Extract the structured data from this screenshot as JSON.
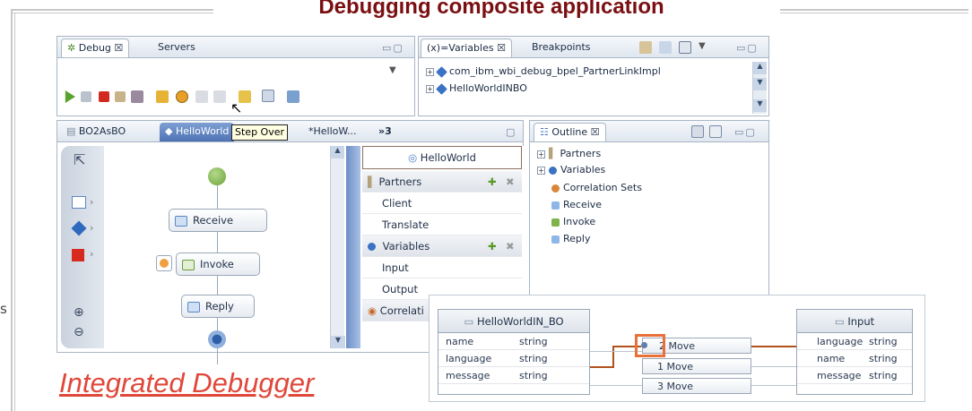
{
  "slide": {
    "title": "Debugging composite application",
    "caption": "Integrated Debugger",
    "edge_mark": "s",
    "title_color": "#7a0f12",
    "caption_color": "#e0473a"
  },
  "debug_view": {
    "tabs": [
      "Debug ☒",
      "Servers"
    ],
    "tooltip": "Step Over"
  },
  "variables_view": {
    "tabs": [
      "(x)=Variables ☒",
      "Breakpoints"
    ],
    "items": [
      "com_ibm_wbi_debug_bpel_PartnerLinkImpl",
      "HelloWorldINBO"
    ]
  },
  "editor": {
    "tabs": [
      "BO2AsBO",
      "HelloWorld",
      "*HelloW...",
      "»3"
    ],
    "process_nodes": [
      "Receive",
      "Invoke",
      "Reply"
    ],
    "process_name": "HelloWorld",
    "partners_label": "Partners",
    "partners": [
      "Client",
      "Translate"
    ],
    "variables_label": "Variables",
    "variables": [
      "Input",
      "Output"
    ],
    "correlation_label": "Correlati"
  },
  "outline_view": {
    "tab": "Outline ☒",
    "items": [
      "Partners",
      "Variables",
      "Correlation Sets",
      "Receive",
      "Invoke",
      "Reply"
    ]
  },
  "mapping": {
    "source": {
      "title": "HelloWorldIN_BO",
      "fields": [
        {
          "name": "name",
          "type": "string"
        },
        {
          "name": "language",
          "type": "string"
        },
        {
          "name": "message",
          "type": "string"
        }
      ]
    },
    "target": {
      "title": "Input",
      "fields": [
        {
          "name": "language",
          "type": "string"
        },
        {
          "name": "name",
          "type": "string"
        },
        {
          "name": "message",
          "type": "string"
        }
      ]
    },
    "moves": [
      {
        "num": "2",
        "label": "Move"
      },
      {
        "num": "1",
        "label": "Move"
      },
      {
        "num": "3",
        "label": "Move"
      }
    ]
  }
}
